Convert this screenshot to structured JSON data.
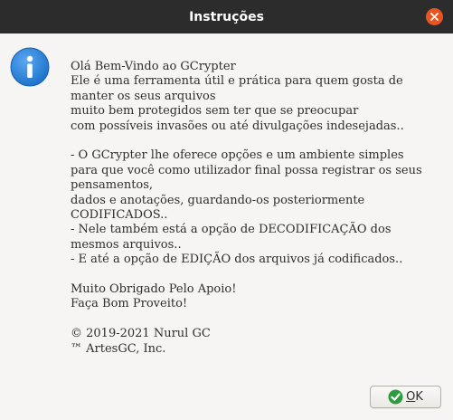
{
  "window": {
    "title": "Instruções",
    "close_icon": "close-icon",
    "accent_color": "#e95420"
  },
  "dialog": {
    "icon": "info-icon",
    "message_lines": [
      "Olá Bem-Vindo ao GCrypter",
      "Ele é uma ferramenta útil e prática para quem gosta de",
      "manter os seus arquivos",
      "muito bem protegidos sem ter que se preocupar",
      "com possíveis invasões ou até divulgações indesejadas..",
      "",
      "- O GCrypter lhe oferece opções e um ambiente simples",
      "para que você como utilizador final possa registrar os seus",
      "pensamentos,",
      "dados e anotações, guardando-os posteriormente",
      "CODIFICADOS..",
      "- Nele também está a opção de DECODIFICAÇÃO dos",
      "mesmos arquivos..",
      "- E até a opção de EDIÇÃO dos arquivos já codificados..",
      "",
      "Muito Obrigado Pelo Apoio!",
      "Faça Bom Proveito!",
      "",
      "© 2019-2021 Nurul GC",
      "™ ArtesGC, Inc."
    ]
  },
  "buttons": {
    "ok": {
      "icon": "check-circle-icon",
      "mnemonic": "O",
      "rest": "K"
    }
  }
}
